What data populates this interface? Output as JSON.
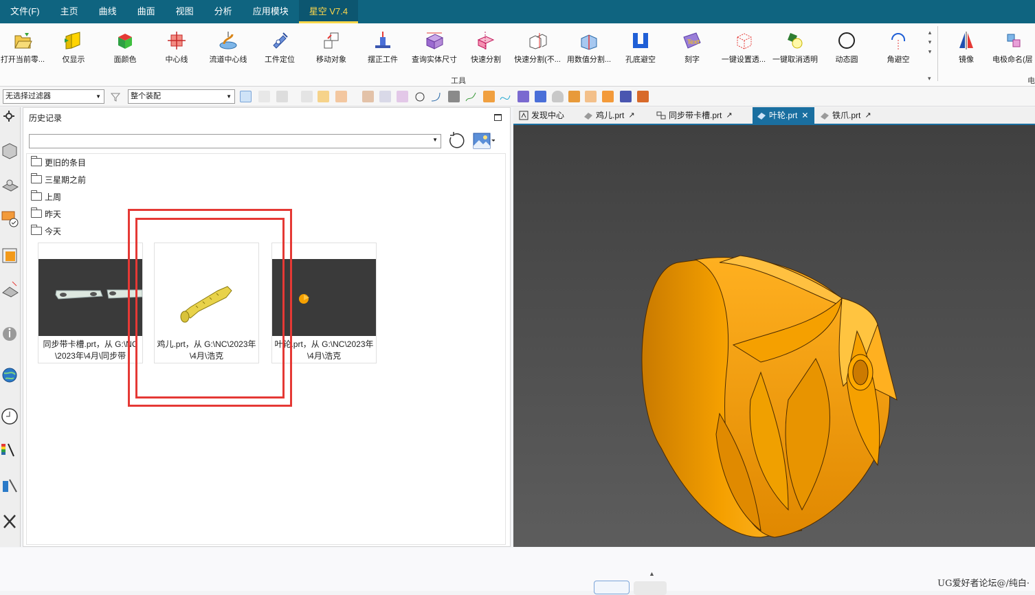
{
  "menu": {
    "items": [
      "文件(F)",
      "主页",
      "曲线",
      "曲面",
      "视图",
      "分析",
      "应用模块",
      "星空 V7.4"
    ]
  },
  "ribbon": {
    "tools": [
      {
        "label": "打开当前零...",
        "icon": "open-part-icon"
      },
      {
        "label": "仅显示",
        "icon": "show-only-icon"
      },
      {
        "label": "面颜色",
        "icon": "face-color-icon"
      },
      {
        "label": "中心线",
        "icon": "center-line-icon"
      },
      {
        "label": "流道中心线",
        "icon": "runner-center-line-icon"
      },
      {
        "label": "工件定位",
        "icon": "workpiece-position-icon"
      },
      {
        "label": "移动对象",
        "icon": "move-object-icon"
      },
      {
        "label": "摆正工件",
        "icon": "align-workpiece-icon"
      },
      {
        "label": "查询实体尺寸",
        "icon": "query-solid-size-icon"
      },
      {
        "label": "快速分割",
        "icon": "quick-split-icon"
      },
      {
        "label": "快速分割(不...",
        "icon": "quick-split-keep-icon"
      },
      {
        "label": "用数值分割...",
        "icon": "numeric-split-icon"
      },
      {
        "label": "孔底避空",
        "icon": "hole-bottom-relief-icon"
      },
      {
        "label": "刻字",
        "icon": "engrave-text-icon"
      },
      {
        "label": "一键设置透...",
        "icon": "set-transparent-icon"
      },
      {
        "label": "一键取消透明",
        "icon": "cancel-transparent-icon"
      },
      {
        "label": "动态圆",
        "icon": "dynamic-circle-icon"
      },
      {
        "label": "角避空",
        "icon": "corner-relief-icon"
      },
      {
        "label": "镜像",
        "icon": "mirror-icon"
      },
      {
        "label": "电极命名(层",
        "icon": "electrode-naming-icon"
      }
    ],
    "group_label": "工具",
    "group_label_right": "电"
  },
  "filterbar": {
    "type_filter": "无选择过滤器",
    "scope": "整个装配"
  },
  "history": {
    "title": "历史记录",
    "search_value": "",
    "folders": [
      "更旧的条目",
      "三星期之前",
      "上周",
      "昨天",
      "今天"
    ],
    "cards": [
      {
        "caption": "同步带卡槽.prt，从 G:\\NC\\2023年\\4月\\同步带",
        "thumb": "sync-belt-slot"
      },
      {
        "caption": "鸡儿.prt，从 G:\\NC\\2023年\\4月\\浩克",
        "thumb": "yellow-part"
      },
      {
        "caption": "叶轮.prt，从 G:\\NC\\2023年\\4月\\浩克",
        "thumb": "impeller-small"
      }
    ]
  },
  "doc_tabs": [
    {
      "label": "发现中心",
      "active": false,
      "closable": false
    },
    {
      "label": "鸡儿.prt",
      "active": false,
      "closable": false
    },
    {
      "label": "同步带卡槽.prt",
      "active": false,
      "closable": false
    },
    {
      "label": "叶轮.prt",
      "active": true,
      "closable": true
    },
    {
      "label": "铁爪.prt",
      "active": false,
      "closable": false
    }
  ],
  "colors": {
    "menubar": "#0f6480",
    "active_menu_text": "#ffd84a",
    "part_orange": "#f5a000",
    "highlight_red": "#e53935",
    "active_tab": "#1a6fa0"
  },
  "watermark": "UG爱好者论坛@/纯白·"
}
